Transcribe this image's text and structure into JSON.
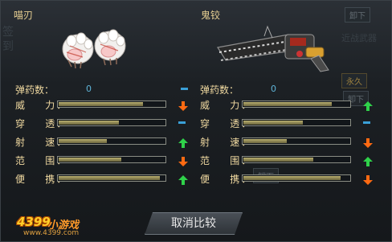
{
  "left_weapon": {
    "name": "喵刃",
    "ammo_label": "弹药数：",
    "ammo_value": "0",
    "stats": [
      {
        "label": "威    力：",
        "value": 0.78,
        "trend": "down"
      },
      {
        "label": "穿    透：",
        "value": 0.56,
        "trend": "same"
      },
      {
        "label": "射    速：",
        "value": 0.45,
        "trend": "up"
      },
      {
        "label": "范    围：",
        "value": 0.58,
        "trend": "down"
      },
      {
        "label": "便    携：",
        "value": 0.94,
        "trend": "up"
      }
    ]
  },
  "right_weapon": {
    "name": "鬼铰",
    "ammo_label": "弹药数：",
    "ammo_value": "0",
    "stats": [
      {
        "label": "威    力：",
        "value": 0.82,
        "trend": "up"
      },
      {
        "label": "穿    透：",
        "value": 0.55,
        "trend": "same"
      },
      {
        "label": "射    速：",
        "value": 0.4,
        "trend": "down"
      },
      {
        "label": "范    围：",
        "value": 0.65,
        "trend": "up"
      },
      {
        "label": "便    携：",
        "value": 0.9,
        "trend": "down"
      }
    ]
  },
  "background": {
    "unload_top": "卸下",
    "unload_mid": "卸下",
    "unload_low": "卸下",
    "melee_weapon": "近战武器",
    "permanent": "永久",
    "side_chars_1": "签",
    "side_chars_2": "到"
  },
  "cancel_button": "取消比较",
  "logo": {
    "num": "4399",
    "game": "小游戏",
    "url": "www.4399.com"
  },
  "colors": {
    "title": "#e7cf92",
    "label": "#f0d9a0",
    "ammo_value": "#5fb4d8",
    "bar_fill": "#a49a5e",
    "up": "#2fd24a",
    "down": "#ff6a12",
    "same": "#3aa0d8"
  }
}
